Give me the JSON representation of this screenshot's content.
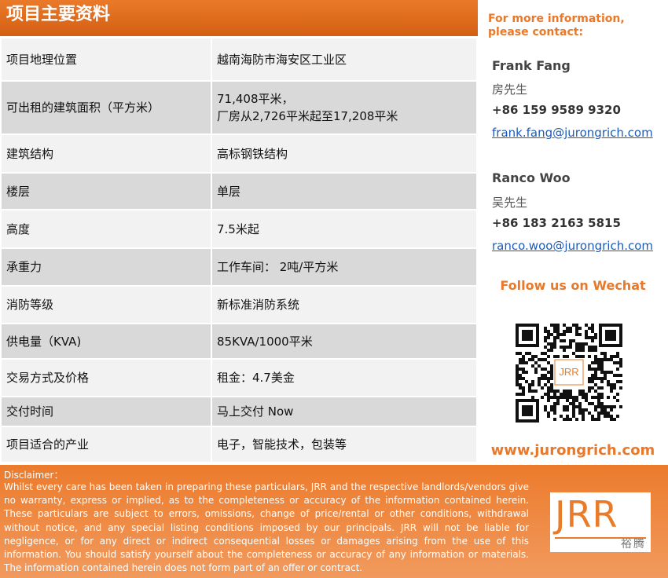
{
  "header": {
    "title": "项目主要资料"
  },
  "specs": [
    {
      "label": "项目地理位置",
      "value": "越南海防市海安区工业区"
    },
    {
      "label": "可出租的建筑面积（平方米）",
      "value": "71,408平米，\n厂房从2,726平米起至17,208平米"
    },
    {
      "label": "建筑结构",
      "value": "高标钢铁结构"
    },
    {
      "label": "楼层",
      "value": "单层"
    },
    {
      "label": "高度",
      "value": "7.5米起"
    },
    {
      "label": "承重力",
      "value": "工作车间： 2吨/平方米"
    },
    {
      "label": "消防等级",
      "value": "新标准消防系统"
    },
    {
      "label": "供电量（KVA)",
      "value": "85KVA/1000平米"
    },
    {
      "label": "交易方式及价格",
      "value": "租金：4.7美金"
    },
    {
      "label": "交付时间",
      "value": "马上交付 Now"
    },
    {
      "label": "项目适合的产业",
      "value": "电子，智能技术，包装等"
    }
  ],
  "contact": {
    "heading": "For more information, please contact:",
    "people": [
      {
        "name": "Frank Fang",
        "cn": "房先生",
        "phone": "+86 159 9589 9320",
        "email": "frank.fang@jurongrich.com"
      },
      {
        "name": "Ranco Woo",
        "cn": "吴先生",
        "phone": "+86 183 2163 5815",
        "email": "ranco.woo@jurongrich.com"
      }
    ],
    "follow": "Follow us on Wechat",
    "qr_logo": "JRR",
    "website": "www.jurongrich.com"
  },
  "disclaimer": {
    "title": "Disclaimer：",
    "body": "Whilst every care has been taken in preparing these particulars, JRR and the respective landlords/vendors give no warranty, express or implied, as to the completeness or accuracy of the information contained herein. These particulars are subject to errors, omissions, change of price/rental or other conditions, withdrawal without notice, and any special listing conditions imposed by our principals. JRR will not be liable for negligence, or for any direct or indirect consequential losses or damages arising from the use of this information. You should satisfy yourself about the completeness or accuracy of any information or materials. The information contained herein does not form part of an offer or contract."
  },
  "logo": {
    "text": "JRR",
    "cn": "裕腾"
  },
  "colors": {
    "accent": "#e8782a",
    "link": "#1f5bb5",
    "row_light": "#f2f2f2",
    "row_dark": "#d9d9d9"
  }
}
